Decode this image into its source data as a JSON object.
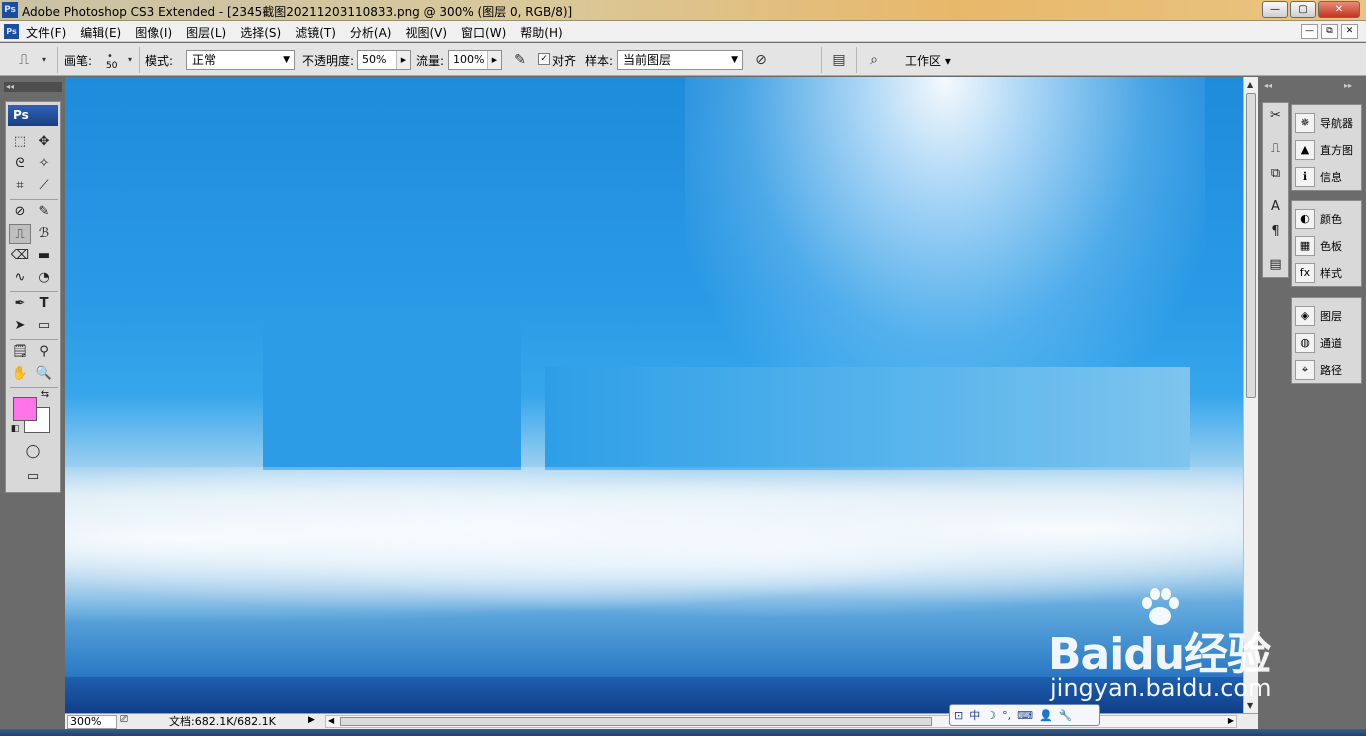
{
  "window": {
    "title": "Adobe Photoshop CS3 Extended - [2345截图20211203110833.png @ 300% (图层 0, RGB/8)]",
    "logo": "Ps",
    "minimize": "—",
    "maximize": "▢",
    "close": "✕"
  },
  "menu": {
    "logo": "Ps",
    "items": [
      "文件(F)",
      "编辑(E)",
      "图像(I)",
      "图层(L)",
      "选择(S)",
      "滤镜(T)",
      "分析(A)",
      "视图(V)",
      "窗口(W)",
      "帮助(H)"
    ],
    "doc_buttons": [
      "—",
      "⧉",
      "✕"
    ]
  },
  "options": {
    "brush_label": "画笔:",
    "brush_size": "50",
    "mode_label": "模式:",
    "mode_value": "正常",
    "opacity_label": "不透明度:",
    "opacity_value": "50%",
    "flow_label": "流量:",
    "flow_value": "100%",
    "align_label": "对齐",
    "align_checked": "✓",
    "sample_label": "样本:",
    "sample_value": "当前图层",
    "workspace_label": "工作区 ▾"
  },
  "toolbox": {
    "collapse": "◂◂",
    "logo": "Ps",
    "foreground_color": "#ff74e8",
    "background_color": "#ffffff"
  },
  "right_panels": {
    "collapse_left": "◂◂",
    "collapse_right": "▸▸",
    "group1": [
      {
        "icon": "navigator-icon",
        "glyph": "✵",
        "label": "导航器"
      },
      {
        "icon": "histogram-icon",
        "glyph": "▲",
        "label": "直方图"
      },
      {
        "icon": "info-icon",
        "glyph": "ℹ",
        "label": "信息"
      }
    ],
    "group2": [
      {
        "icon": "color-icon",
        "glyph": "◐",
        "label": "颜色"
      },
      {
        "icon": "swatches-icon",
        "glyph": "▦",
        "label": "色板"
      },
      {
        "icon": "styles-icon",
        "glyph": "fx",
        "label": "样式"
      }
    ],
    "group3": [
      {
        "icon": "layers-icon",
        "glyph": "◈",
        "label": "图层"
      },
      {
        "icon": "channels-icon",
        "glyph": "◍",
        "label": "通道"
      },
      {
        "icon": "paths-icon",
        "glyph": "⌖",
        "label": "路径"
      }
    ]
  },
  "status": {
    "zoom": "300%",
    "doc_info": "文档:682.1K/682.1K"
  },
  "watermark": {
    "brand": "Baidu经验",
    "url": "jingyan.baidu.com"
  },
  "ime": {
    "items": [
      "中",
      "☽",
      "°,",
      "⌨",
      "👤",
      "🔧"
    ]
  },
  "colors": {
    "accent": "#1c4e9e"
  }
}
